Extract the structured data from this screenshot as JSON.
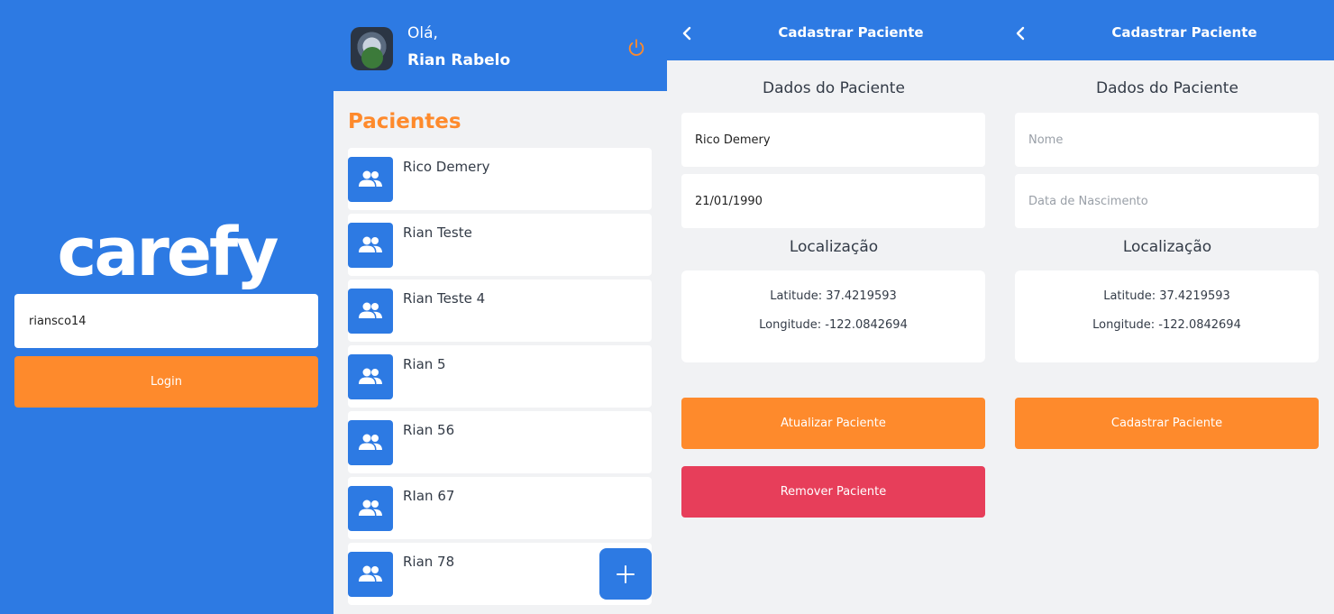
{
  "login": {
    "logo_text": "carefy",
    "username_value": "riansco14",
    "login_label": "Login"
  },
  "list": {
    "greeting": "Olá,",
    "user_name": "Rian Rabelo",
    "title": "Pacientes",
    "patients": [
      {
        "name": "Rico Demery"
      },
      {
        "name": "Rian Teste"
      },
      {
        "name": "Rian Teste 4"
      },
      {
        "name": "Rian 5"
      },
      {
        "name": "Rian 56"
      },
      {
        "name": "RIan 67"
      },
      {
        "name": "Rian 78"
      }
    ],
    "fab_icon": "plus-icon"
  },
  "edit_form": {
    "title": "Cadastrar Paciente",
    "section_patient": "Dados do Paciente",
    "name_value": "Rico Demery",
    "birth_value": "21/01/1990",
    "section_location": "Localização",
    "latitude": "Latitude: 37.4219593",
    "longitude": "Longitude: -122.0842694",
    "update_label": "Atualizar Paciente",
    "remove_label": "Remover Paciente"
  },
  "new_form": {
    "title": "Cadastrar Paciente",
    "section_patient": "Dados do Paciente",
    "name_placeholder": "Nome",
    "birth_placeholder": "Data de Nascimento",
    "section_location": "Localização",
    "latitude": "Latitude: 37.4219593",
    "longitude": "Longitude: -122.0842694",
    "submit_label": "Cadastrar Paciente"
  },
  "colors": {
    "primary_blue": "#2d7ae3",
    "accent_orange": "#fe8a2c",
    "danger_red": "#e73e5a",
    "background": "#f1f2f4"
  }
}
